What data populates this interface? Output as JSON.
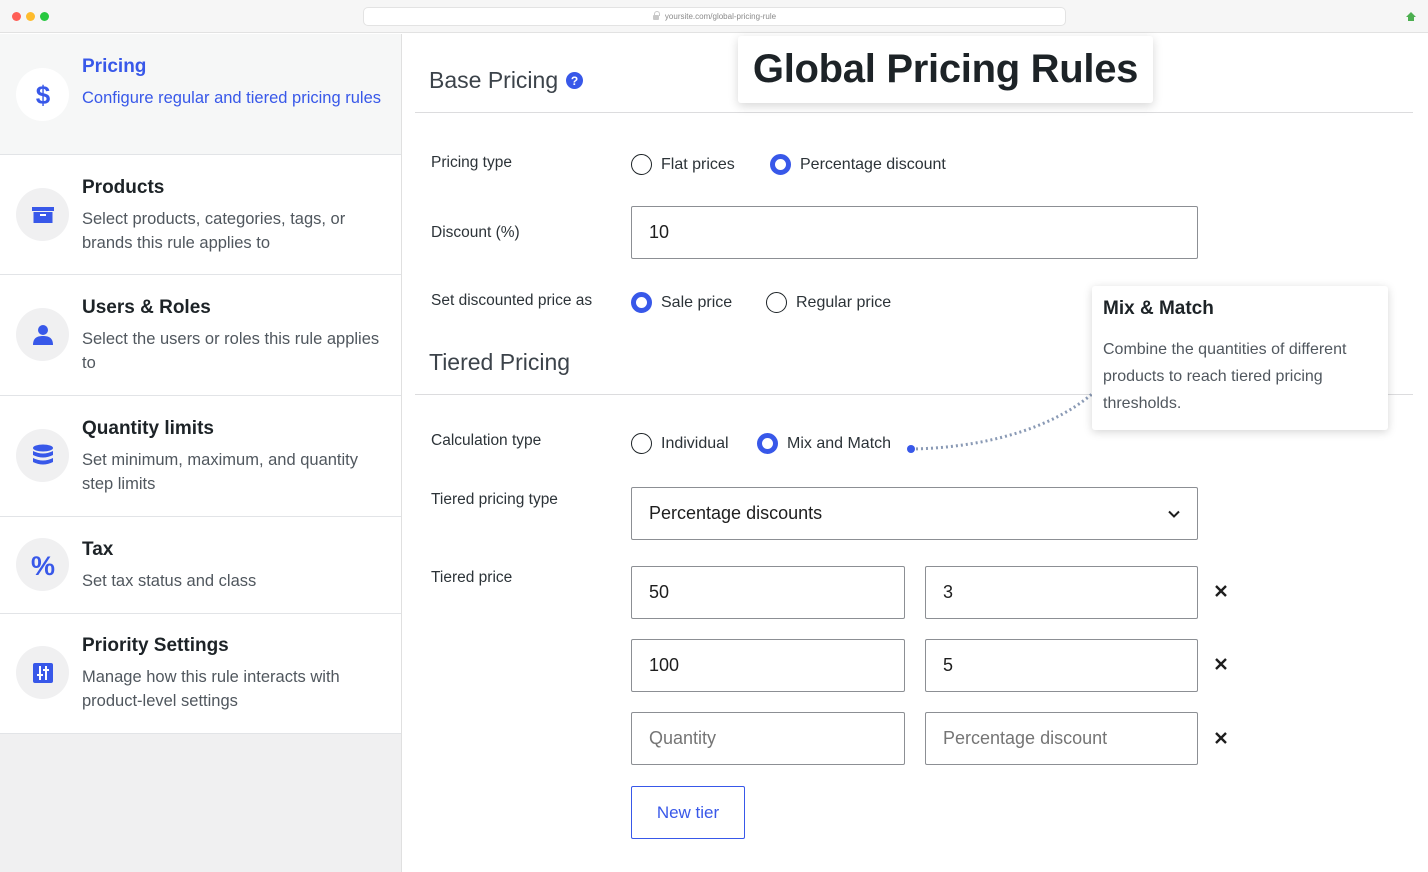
{
  "browser": {
    "url": "yoursite.com/global-pricing-rule"
  },
  "headline": "Global Pricing Rules",
  "sidebar": {
    "items": [
      {
        "title": "Pricing",
        "desc": "Configure regular and tiered pricing rules",
        "icon": "dollar-icon",
        "active": true
      },
      {
        "title": "Products",
        "desc": "Select products, categories, tags, or brands this rule applies to",
        "icon": "archive-box-icon"
      },
      {
        "title": "Users & Roles",
        "desc": "Select the users or roles this rule applies to",
        "icon": "user-icon"
      },
      {
        "title": "Quantity limits",
        "desc": "Set minimum, maximum, and quantity step limits",
        "icon": "database-stack-icon"
      },
      {
        "title": "Tax",
        "desc": "Set tax status and class",
        "icon": "percent-icon"
      },
      {
        "title": "Priority Settings",
        "desc": "Manage how this rule interacts with product-level settings",
        "icon": "sliders-icon"
      }
    ]
  },
  "base_pricing": {
    "title": "Base Pricing",
    "help": "?",
    "pricing_type": {
      "label": "Pricing type",
      "options": [
        "Flat prices",
        "Percentage discount"
      ],
      "selected": "Percentage discount"
    },
    "discount": {
      "label": "Discount (%)",
      "value": "10"
    },
    "set_as": {
      "label": "Set discounted price as",
      "options": [
        "Sale price",
        "Regular price"
      ],
      "selected": "Sale price"
    }
  },
  "tiered_pricing": {
    "title": "Tiered Pricing",
    "calculation_type": {
      "label": "Calculation type",
      "options": [
        "Individual",
        "Mix and Match"
      ],
      "selected": "Mix and Match"
    },
    "tiered_type": {
      "label": "Tiered pricing type",
      "value": "Percentage discounts"
    },
    "tiered_price": {
      "label": "Tiered price",
      "rows": [
        {
          "quantity": "50",
          "discount": "3"
        },
        {
          "quantity": "100",
          "discount": "5"
        }
      ],
      "placeholders": {
        "quantity": "Quantity",
        "discount": "Percentage discount"
      }
    },
    "new_tier_label": "New tier"
  },
  "tooltip": {
    "title": "Mix & Match",
    "body": "Combine the quantities of different products to reach tiered pricing thresholds."
  },
  "colors": {
    "accent": "#3858e9",
    "text": "#1d2327",
    "muted": "#50575e",
    "sidebar_bg": "#f0f0f1"
  }
}
